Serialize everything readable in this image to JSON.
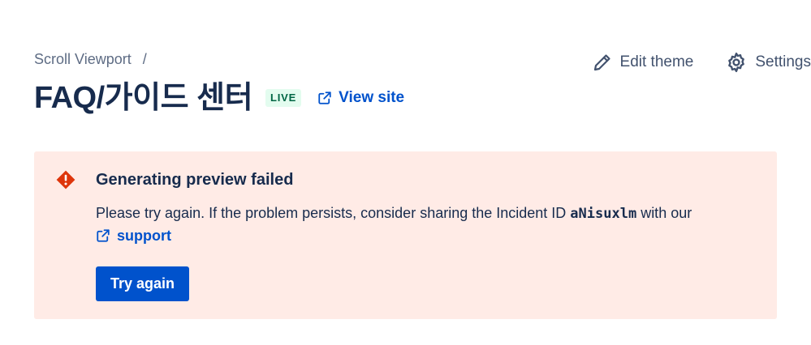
{
  "breadcrumb": {
    "parent": "Scroll Viewport",
    "separator": "/"
  },
  "header": {
    "title": "FAQ/가이드 센터",
    "status_badge": "LIVE",
    "view_site_label": "View site"
  },
  "actions": {
    "edit_theme_label": "Edit theme",
    "settings_label": "Settings"
  },
  "error": {
    "title": "Generating preview failed",
    "message_before": "Please try again. If the problem persists, consider sharing the Incident ID ",
    "incident_id": "aNisuxlm",
    "message_after": " with our",
    "support_label": "support",
    "retry_label": "Try again"
  },
  "icons": {
    "edit": "pencil-icon",
    "settings": "gear-icon",
    "external": "external-link-icon",
    "error": "error-diamond-icon"
  },
  "colors": {
    "primary": "#0052cc",
    "error_bg": "#ffebe6",
    "error_icon": "#de350b",
    "live_bg": "#e3fcef",
    "live_text": "#006644",
    "text": "#172b4d"
  }
}
